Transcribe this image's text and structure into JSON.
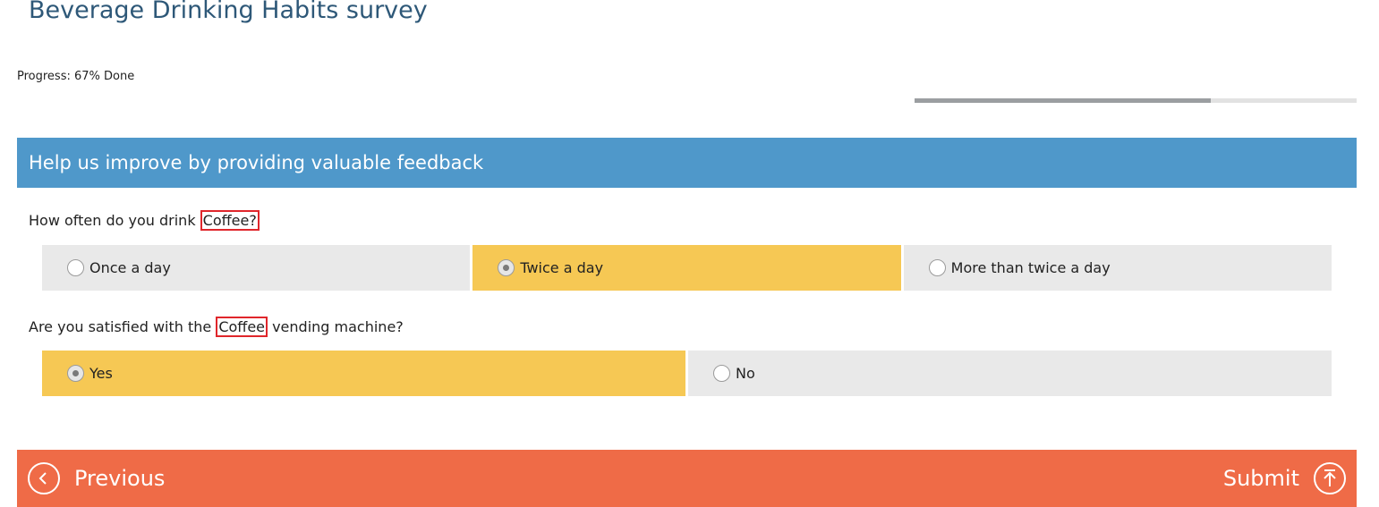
{
  "survey": {
    "title": "Beverage Drinking Habits survey"
  },
  "progress": {
    "label": "Progress: 67% Done",
    "value_percent": 67
  },
  "section": {
    "header": "Help us improve by providing valuable feedback"
  },
  "questions": [
    {
      "before": "How often do you drink ",
      "highlight": "Coffee?",
      "after": "",
      "options": [
        {
          "label": "Once a day",
          "selected": false
        },
        {
          "label": "Twice a day",
          "selected": true
        },
        {
          "label": "More than twice a day",
          "selected": false
        }
      ]
    },
    {
      "before": "Are you satisfied with the ",
      "highlight": "Coffee",
      "after": " vending machine?",
      "options": [
        {
          "label": "Yes",
          "selected": true
        },
        {
          "label": "No",
          "selected": false
        }
      ]
    }
  ],
  "footer": {
    "previous_label": "Previous",
    "submit_label": "Submit"
  },
  "colors": {
    "title": "#2e5878",
    "section_header": "#4f98ca",
    "selected_option": "#f6c854",
    "unselected_option": "#e9e9e9",
    "footer": "#ef6b47",
    "highlight_border": "#e0262b"
  },
  "icons": {
    "previous": "chevron-left-circle-icon",
    "submit": "arrow-up-circle-icon"
  }
}
